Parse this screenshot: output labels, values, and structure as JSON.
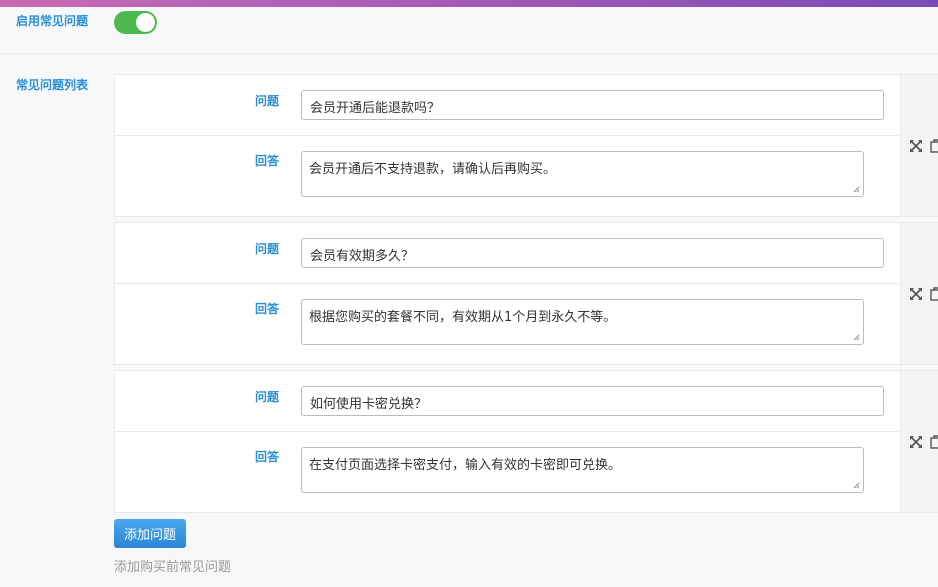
{
  "settings": {
    "enable_label": "启用常见问题",
    "enable_on": true,
    "list_label": "常见问题列表"
  },
  "faq_items": [
    {
      "question_label": "问题",
      "question": "会员开通后能退款吗？",
      "answer_label": "回答",
      "answer": "会员开通后不支持退款，请确认后再购买。"
    },
    {
      "question_label": "问题",
      "question": "会员有效期多久？",
      "answer_label": "回答",
      "answer": "根据您购买的套餐不同，有效期从1个月到永久不等。"
    },
    {
      "question_label": "问题",
      "question": "如何使用卡密兑换？",
      "answer_label": "回答",
      "answer": "在支付页面选择卡密支付，输入有效的卡密即可兑换。"
    }
  ],
  "actions": {
    "add_label": "添加问题",
    "hint": "添加购买前常见问题"
  },
  "colors": {
    "accent": "#2b8fd6",
    "toggle_on": "#4cb94f",
    "button": "#2a86d6"
  },
  "icons": [
    "expand-icon",
    "copy-icon"
  ]
}
